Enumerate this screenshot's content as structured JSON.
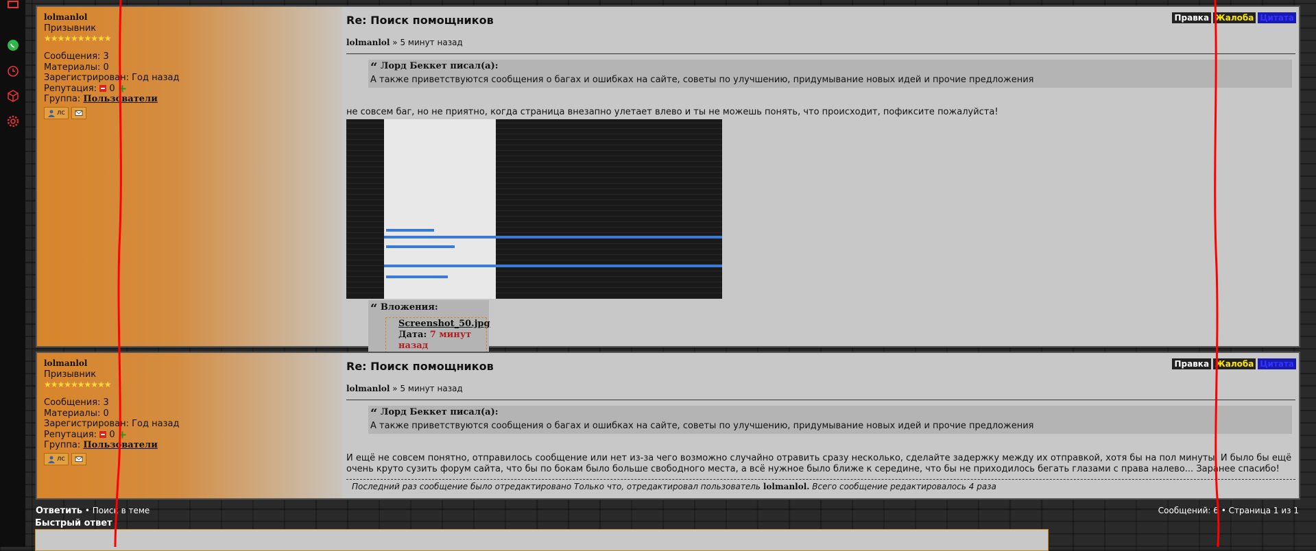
{
  "sidebar": {
    "icons": [
      "window-icon",
      "whatsapp-icon",
      "clock-icon",
      "cube-icon",
      "gear-icon"
    ]
  },
  "posts": [
    {
      "author": {
        "nick": "lolmanlol",
        "rank": "Призывник",
        "stars": "★★★★★★★★★★",
        "messages": "Сообщения: 3",
        "materials": "Материалы: 0",
        "registered": "Зарегистрирован: Год назад",
        "reputation_label": "Репутация:",
        "reputation_value": "0",
        "group_label": "Группа:",
        "group_value": "Пользователи",
        "pm_label": "лс"
      },
      "title": "Re: Поиск помощников",
      "meta_author": "lolmanlol",
      "meta_time": "» 5 минут назад",
      "actions": {
        "edit": "Правка",
        "complain": "Жалоба",
        "quote": "Цитата"
      },
      "quote": {
        "header": "Лорд Беккет писал(а):",
        "text": "А также приветствуются сообщения о багах и ошибках на сайте, советы по улучшению, придумывание новых идей и прочие предложения"
      },
      "text": "не совсем баг, но не приятно, когда страница внезапно улетает влево и ты не можешь понять, что происходит, пофиксите пожалуйста!",
      "attachments": {
        "header": "Вложения:",
        "file_name": "Screenshot_50.jpg",
        "date_label": "Дата:",
        "date_value": "7 минут назад"
      }
    },
    {
      "author": {
        "nick": "lolmanlol",
        "rank": "Призывник",
        "stars": "★★★★★★★★★★",
        "messages": "Сообщения: 3",
        "materials": "Материалы: 0",
        "registered": "Зарегистрирован: Год назад",
        "reputation_label": "Репутация:",
        "reputation_value": "0",
        "group_label": "Группа:",
        "group_value": "Пользователи",
        "pm_label": "лс"
      },
      "title": "Re: Поиск помощников",
      "meta_author": "lolmanlol",
      "meta_time": "» 5 минут назад",
      "actions": {
        "edit": "Правка",
        "complain": "Жалоба",
        "quote": "Цитата"
      },
      "quote": {
        "header": "Лорд Беккет писал(а):",
        "text": "А также приветствуются сообщения о багах и ошибках на сайте, советы по улучшению, придумывание новых идей и прочие предложения"
      },
      "text": "И ещё не совсем понятно, отправилось сообщение или нет из-за чего возможно случайно отравить сразу несколько, сделайте задержку между их отправкой, хотя бы на пол минуты. И было бы ещё очень круто сузить форум сайта, что бы по бокам было больше свободного места, а всё нужное было ближе к середине, что бы не приходилось бегать глазами с права налево... Заранее спасибо!",
      "edit_note_prefix": "Последний раз сообщение было отредактировано Только что, отредактировал пользователь",
      "edit_note_user": "lolmanlol.",
      "edit_note_suffix": "Всего сообщение редактировалось 4 раза"
    }
  ],
  "footer": {
    "reply": "Ответить",
    "search_in_topic": "• Поиск в теме",
    "messages_count": "Сообщений: 6 • Страница 1 из 1",
    "quick_reply": "Быстрый ответ"
  },
  "colors": {
    "accent": "#d9852b",
    "annotation": "#ff0000"
  }
}
